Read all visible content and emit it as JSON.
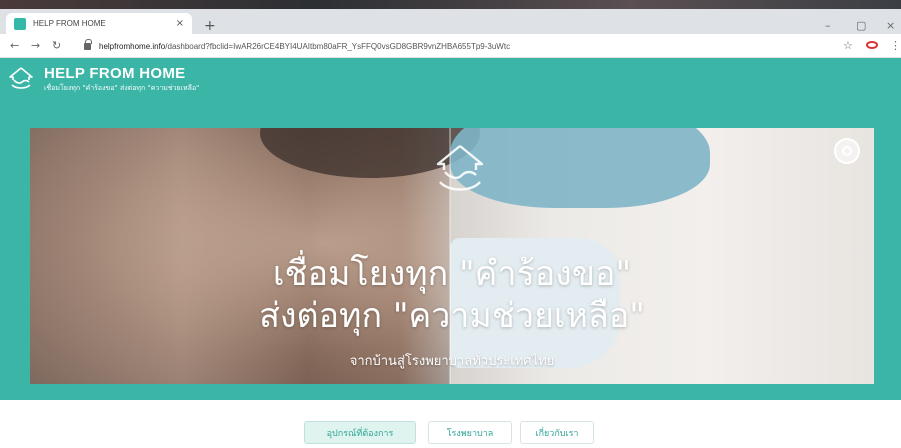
{
  "browser": {
    "tab_title": "HELP FROM HOME",
    "tab_close": "×",
    "new_tab": "+",
    "window_controls": {
      "minimize": "–",
      "maximize": "▢",
      "close": "×"
    },
    "url_host": "helpfromhome.info",
    "url_path": "/dashboard?fbclid=IwAR26rCE4BYI4UAItbm80aFR_YsFFQ0vsGD8GBR9vnZHBA655Tp9-3uWtc",
    "icons": {
      "back": "arrow-left-icon",
      "forward": "arrow-right-icon",
      "reload": "reload-icon",
      "bookmark": "star-icon",
      "menu": "kebab-menu-icon"
    }
  },
  "header": {
    "brand_title": "HELP FROM HOME",
    "tagline": "เชื่อมโยงทุก \"คำร้องขอ\" ส่งต่อทุก \"ความช่วยเหลือ\""
  },
  "hero": {
    "headline_1": "เชื่อมโยงทุก \"คำร้องขอ\"",
    "headline_2": "ส่งต่อทุก \"ความช่วยเหลือ\"",
    "subheadline": "จากบ้านสู่โรงพยาบาลทั่วประเทศไทย"
  },
  "nav": {
    "items": [
      {
        "label": "อุปกรณ์ที่ต้องการ",
        "active": true
      },
      {
        "label": "โรงพยาบาล",
        "active": false
      },
      {
        "label": "เกี่ยวกับเรา",
        "active": false
      }
    ]
  },
  "colors": {
    "brand_teal": "#3ab5a6",
    "nav_text": "#2fa596"
  }
}
